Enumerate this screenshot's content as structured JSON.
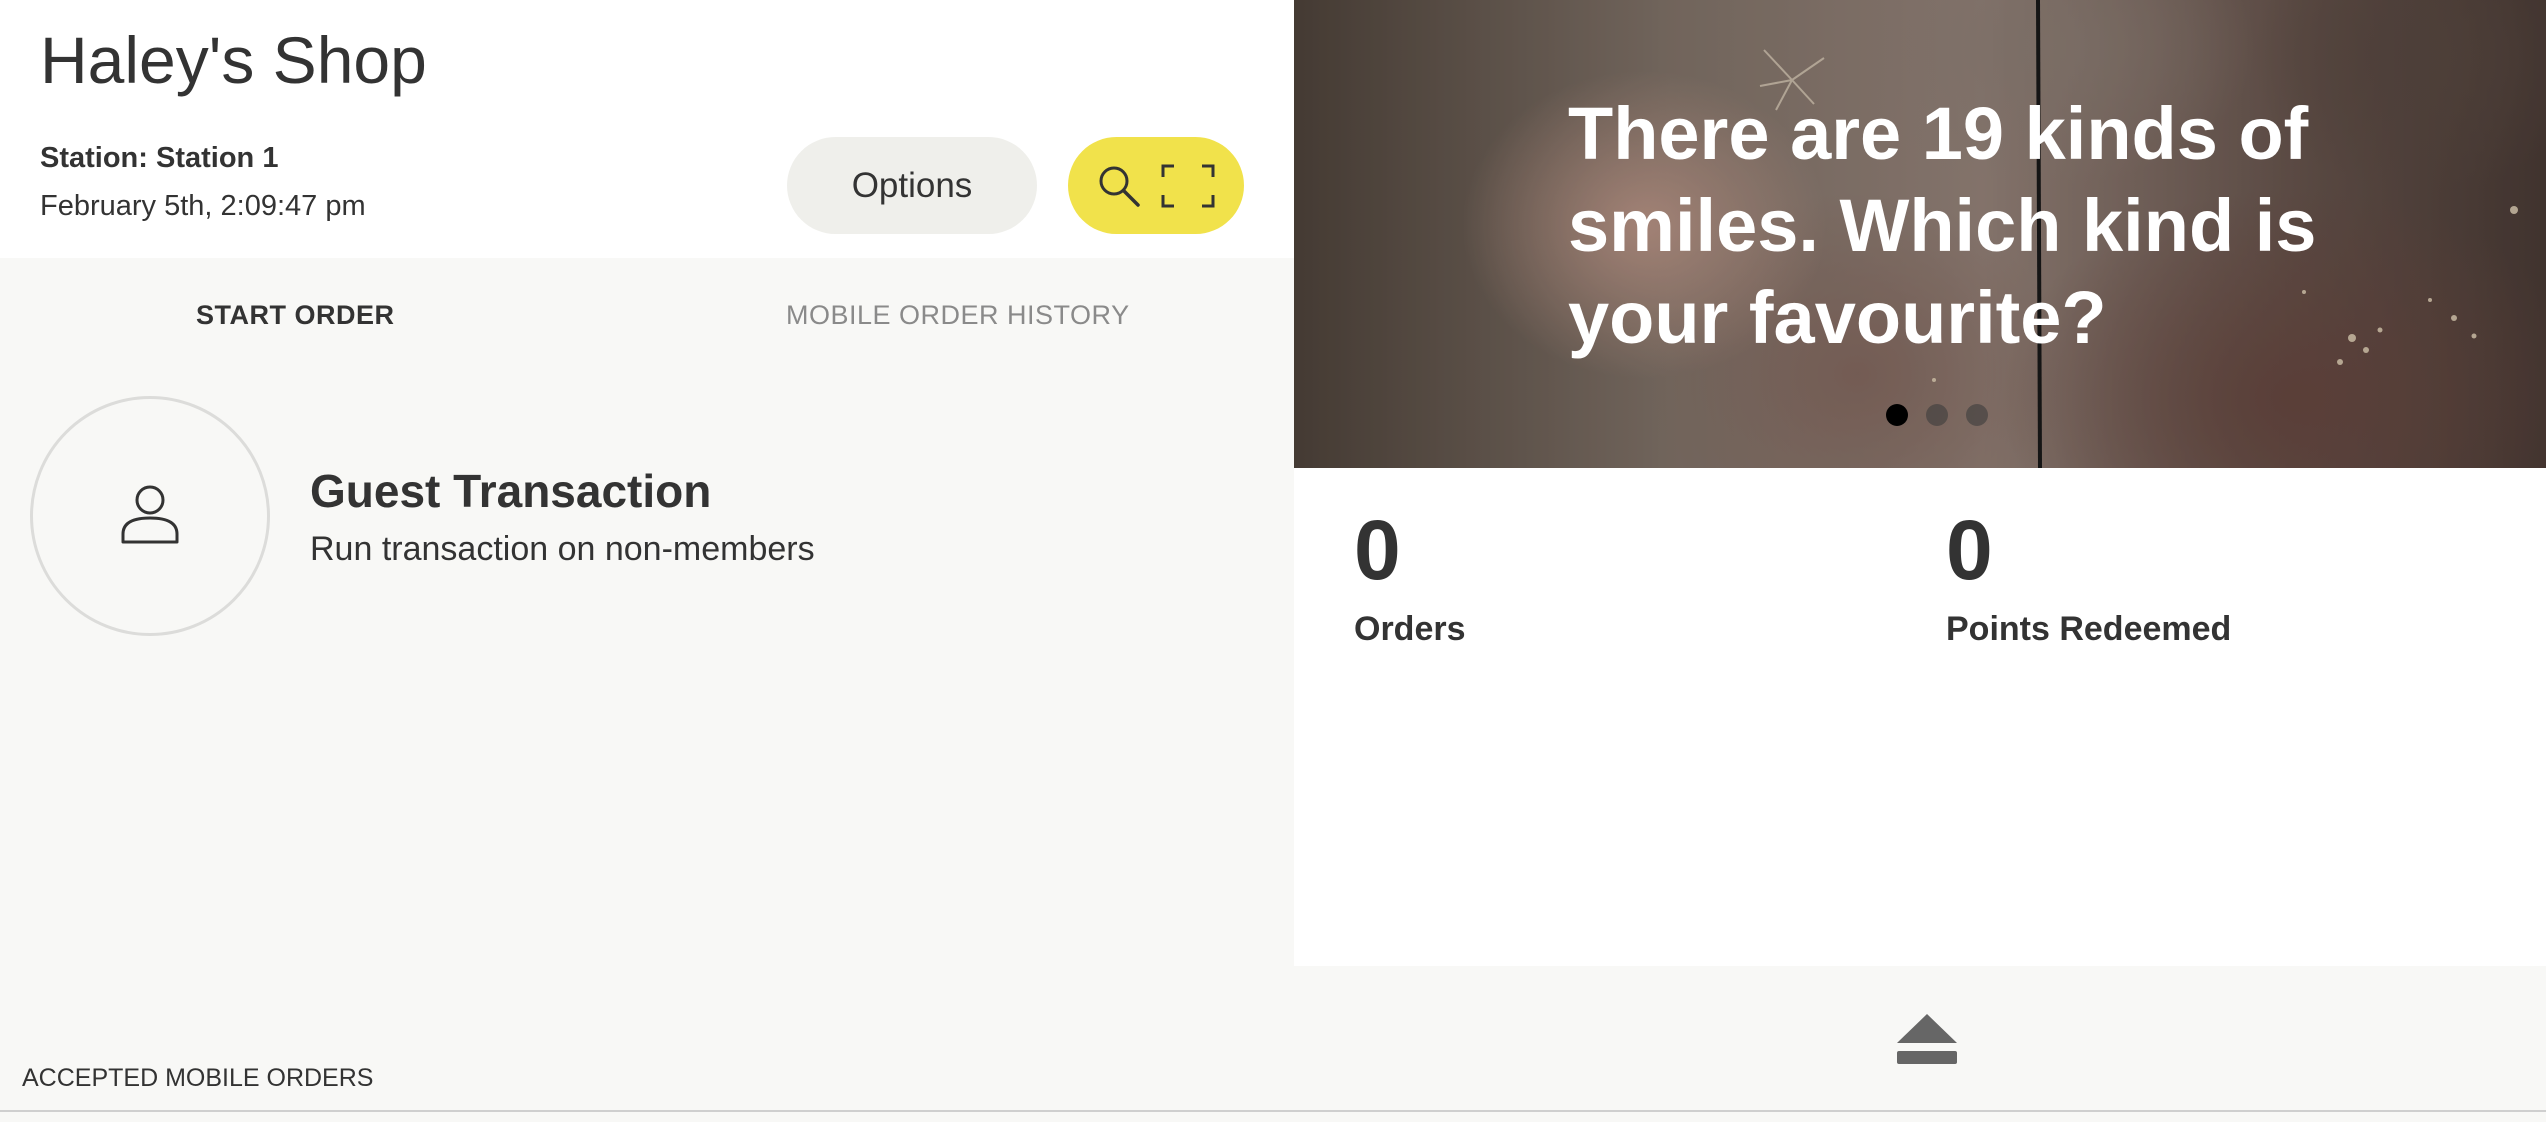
{
  "header": {
    "shop_name": "Haley's Shop",
    "station": "Station: Station 1",
    "datetime": "February 5th, 2:09:47 pm",
    "options_label": "Options",
    "scan_icons": [
      "search-icon",
      "scan-frame-icon"
    ],
    "scan_button_color": "#f1e24b"
  },
  "tabs": [
    {
      "label": "START ORDER",
      "active": true
    },
    {
      "label": "MOBILE ORDER HISTORY",
      "active": false
    }
  ],
  "guest": {
    "icon": "user-icon",
    "title": "Guest Transaction",
    "subtitle": "Run transaction on non-members"
  },
  "footer": {
    "accepted_label": "ACCEPTED MOBILE ORDERS"
  },
  "promo": {
    "text": "There are 19 kinds of smiles. Which kind is your favourite?",
    "slides": 3,
    "active_slide": 1
  },
  "stats": [
    {
      "value": "0",
      "label": "Orders"
    },
    {
      "value": "0",
      "label": "Points Redeemed"
    }
  ],
  "drawer": {
    "icon": "eject-icon"
  }
}
